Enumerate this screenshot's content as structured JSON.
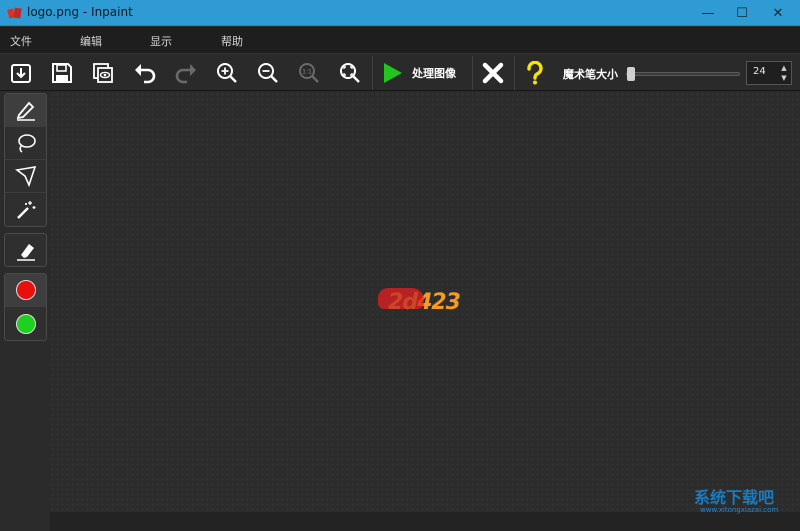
{
  "window": {
    "title": "logo.png - Inpaint",
    "minimize": "—",
    "maximize": "☐",
    "close": "✕"
  },
  "menu": {
    "items": [
      {
        "label": "文件"
      },
      {
        "label": "编辑"
      },
      {
        "label": "显示"
      },
      {
        "label": "帮助"
      }
    ]
  },
  "toolbar": {
    "open": "open-icon",
    "save": "save-icon",
    "preview": "preview-icon",
    "undo": "undo-icon",
    "redo": "redo-icon",
    "zoom_in": "zoom-in-icon",
    "zoom_out": "zoom-out-icon",
    "zoom_actual": "1:1",
    "zoom_fit": "zoom-fit-icon",
    "process_label": "处理图像",
    "brush_size_label": "魔术笔大小",
    "brush_size_value": "24",
    "brush_size_fraction": 0.05,
    "accent_green": "#22c51b",
    "help_color": "#f5e400"
  },
  "tools": {
    "marker": "marker-icon",
    "lasso": "lasso-icon",
    "polygon_lasso": "polygon-lasso-icon",
    "magic_wand": "magic-wand-icon",
    "eraser": "eraser-icon",
    "red_color": "#e8100f",
    "green_color": "#1fd01f"
  },
  "canvas": {
    "logo_text_part1": "2d",
    "logo_text_part2": "423"
  },
  "watermark": {
    "text": "系统下载吧",
    "sub": "www.xitongxiazai.com"
  }
}
